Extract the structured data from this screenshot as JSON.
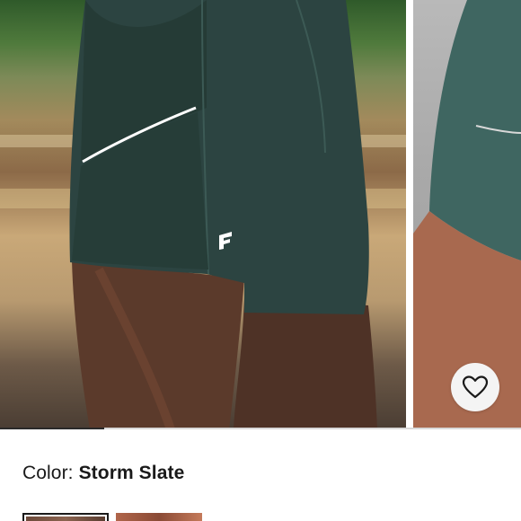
{
  "product": {
    "color_label": "Color: ",
    "color_name": "Storm Slate"
  },
  "gallery": {
    "images": [
      {
        "alt": "storm-slate-shorts-back-view"
      },
      {
        "alt": "storm-slate-shorts-side-view"
      }
    ],
    "progress_fraction": 0.2,
    "favorite_icon": "heart-icon"
  },
  "swatches": [
    {
      "name": "swatch-1",
      "selected": true
    },
    {
      "name": "swatch-2",
      "selected": false
    }
  ],
  "colors": {
    "shorts": "#2c4441",
    "shorts_dark": "#22362f",
    "skin": "#5a3a2c",
    "text": "#1a1a1a",
    "progress_fill": "#2a2a2a",
    "progress_track": "#d9d9d9"
  }
}
